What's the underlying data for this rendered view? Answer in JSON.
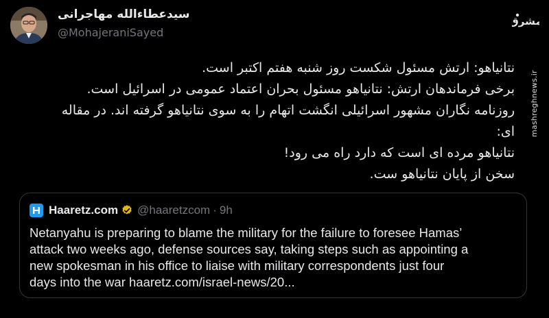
{
  "author": {
    "name": "سیدعطاءالله مهاجرانی",
    "handle": "@MohajeraniSayed"
  },
  "tweet": {
    "lines": [
      "نتانیاهو: ارتش مسئول شکست روز شنبه هفتم اکتبر است.",
      "برخی فرماندهان ارتش: نتانیاهو مسئول بحران اعتماد عمومی در اسرائیل است.",
      "روزنامه نگاران مشهور اسرائیلی انگشت اتهام را به سوی نتانیاهو گرفته اند. در مقاله",
      "ای:",
      "نتانیاهو مرده ای است که دارد راه می رود!",
      "سخن از پایان نتانیاهو ست."
    ]
  },
  "quote": {
    "name": "Haaretz.com",
    "handle": "@haaretzcom",
    "separator": "·",
    "time": "9h",
    "lines": [
      "Netanyahu is preparing to blame the military for the failure to foresee Hamas’",
      "attack two weeks ago, defense sources say, taking steps such as appointing a",
      "new spokesman in his office to liaise with military correspondents just four",
      "days into the war haaretz.com/israel-news/20..."
    ]
  },
  "watermark": {
    "logo_text": "مشرق",
    "site": "mashreghnews.ir"
  },
  "colors": {
    "background": "#000000",
    "text": "#e7e9ea",
    "muted": "#71767b",
    "border": "#333639",
    "verified": "#e2b719",
    "haaretz_logo": "#1d9bf0"
  },
  "icons": {
    "verified": "verified-badge-icon",
    "haaretz": "haaretz-logo-icon"
  }
}
